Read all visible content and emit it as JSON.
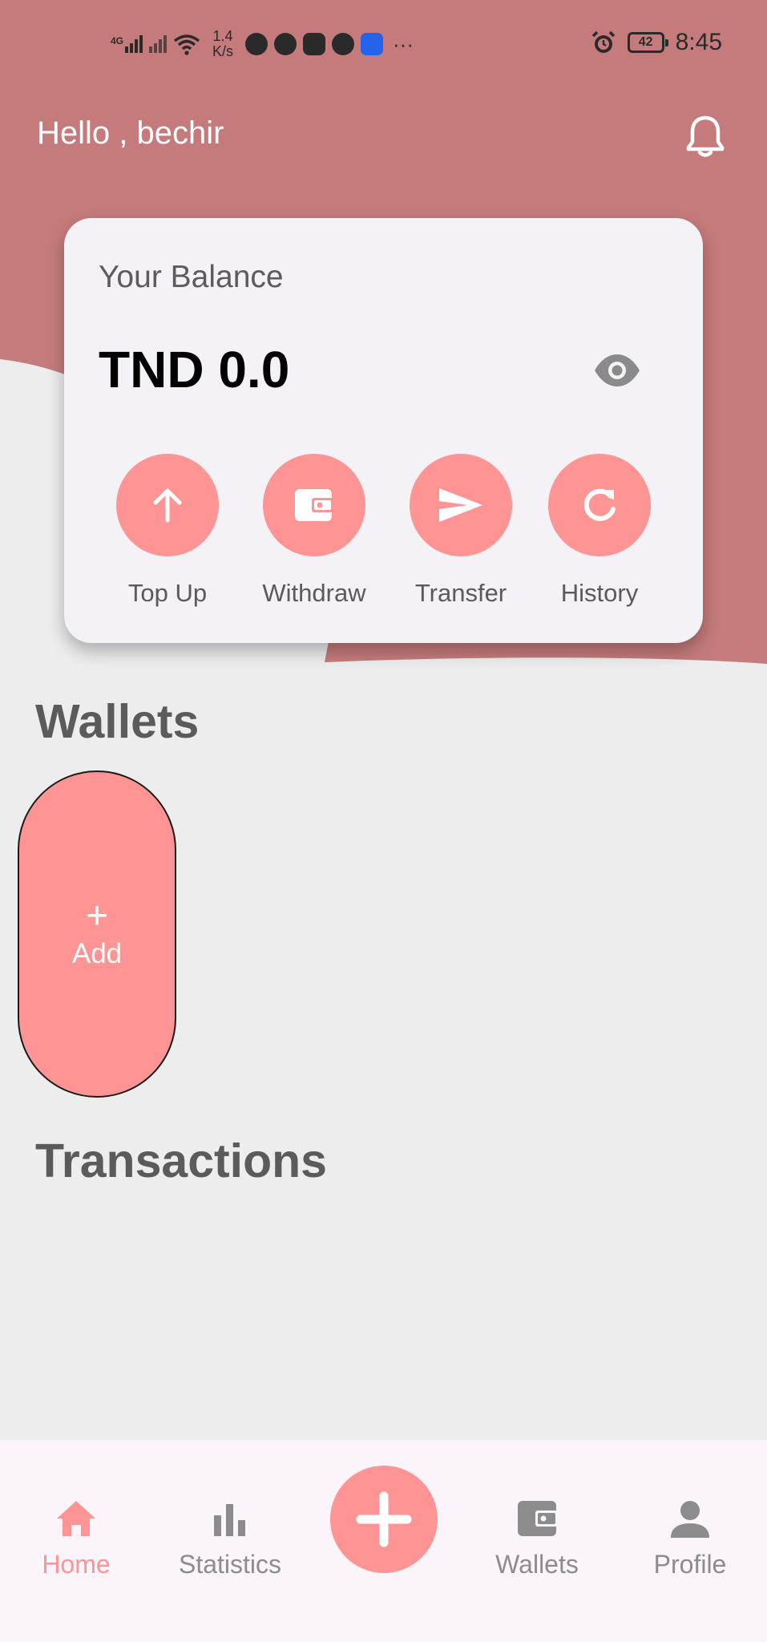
{
  "status_bar": {
    "network": "4G",
    "speed_value": "1.4",
    "speed_unit": "K/s",
    "battery": "42",
    "time": "8:45"
  },
  "header": {
    "greeting": "Hello , bechir"
  },
  "balance": {
    "label": "Your Balance",
    "amount": "TND 0.0"
  },
  "actions": [
    {
      "label": "Top Up",
      "icon": "arrow-up-icon"
    },
    {
      "label": "Withdraw",
      "icon": "wallet-icon"
    },
    {
      "label": "Transfer",
      "icon": "send-icon"
    },
    {
      "label": "History",
      "icon": "refresh-icon"
    }
  ],
  "wallets": {
    "title": "Wallets",
    "add_plus": "+",
    "add_label": "Add"
  },
  "transactions": {
    "title": "Transactions"
  },
  "nav": {
    "items": [
      {
        "label": "Home",
        "icon": "home-icon",
        "active": true
      },
      {
        "label": "Statistics",
        "icon": "bar-chart-icon",
        "active": false
      },
      {
        "label": "Wallets",
        "icon": "wallet-icon",
        "active": false
      },
      {
        "label": "Profile",
        "icon": "person-icon",
        "active": false
      }
    ],
    "fab_icon": "plus-icon"
  },
  "colors": {
    "header_bg": "#c57b7b",
    "accent": "#fe9493",
    "page_bg": "#ededed",
    "card_bg": "#f4f1f7"
  }
}
